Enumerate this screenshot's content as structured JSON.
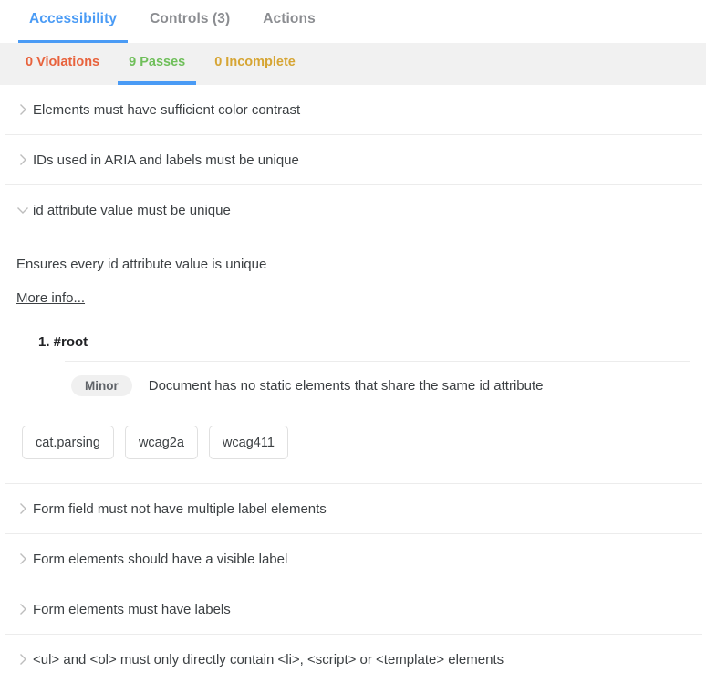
{
  "tabs": [
    {
      "label": "Accessibility",
      "active": true
    },
    {
      "label": "Controls (3)",
      "active": false
    },
    {
      "label": "Actions",
      "active": false
    }
  ],
  "subtabs": [
    {
      "label": "0 Violations",
      "color": "#e8623c",
      "active": false
    },
    {
      "label": "9 Passes",
      "color": "#6fbf5a",
      "active": true
    },
    {
      "label": "0 Incomplete",
      "color": "#d6a534",
      "active": false
    }
  ],
  "colors": {
    "accent": "#4a9bf5",
    "violations": "#e8623c",
    "passes": "#6fbf5a",
    "incomplete": "#d6a534",
    "text": "#3c4043",
    "muted": "#8b8d91",
    "subtab_bg": "#f1f1f1",
    "separator": "#ececec",
    "badge_bg": "#f0f0f0",
    "chip_border": "#e0e0e0"
  },
  "rules": [
    {
      "title": "Elements must have sufficient color contrast",
      "expanded": false,
      "icon": "chevron-right-icon"
    },
    {
      "title": "IDs used in ARIA and labels must be unique",
      "expanded": false,
      "icon": "chevron-right-icon"
    },
    {
      "title": "id attribute value must be unique",
      "expanded": true,
      "icon": "chevron-down-icon",
      "detail": {
        "description": "Ensures every id attribute value is unique",
        "more_info_label": "More info...",
        "node_title": "1. #root",
        "impact_badge": "Minor",
        "impact_message": "Document has no static elements that share the same id attribute",
        "tags": [
          "cat.parsing",
          "wcag2a",
          "wcag411"
        ]
      }
    },
    {
      "title": "Form field must not have multiple label elements",
      "expanded": false,
      "icon": "chevron-right-icon"
    },
    {
      "title": "Form elements should have a visible label",
      "expanded": false,
      "icon": "chevron-right-icon"
    },
    {
      "title": "Form elements must have labels",
      "expanded": false,
      "icon": "chevron-right-icon"
    },
    {
      "title": "<ul> and <ol> must only directly contain <li>, <script> or <template> elements",
      "expanded": false,
      "icon": "chevron-right-icon"
    }
  ]
}
